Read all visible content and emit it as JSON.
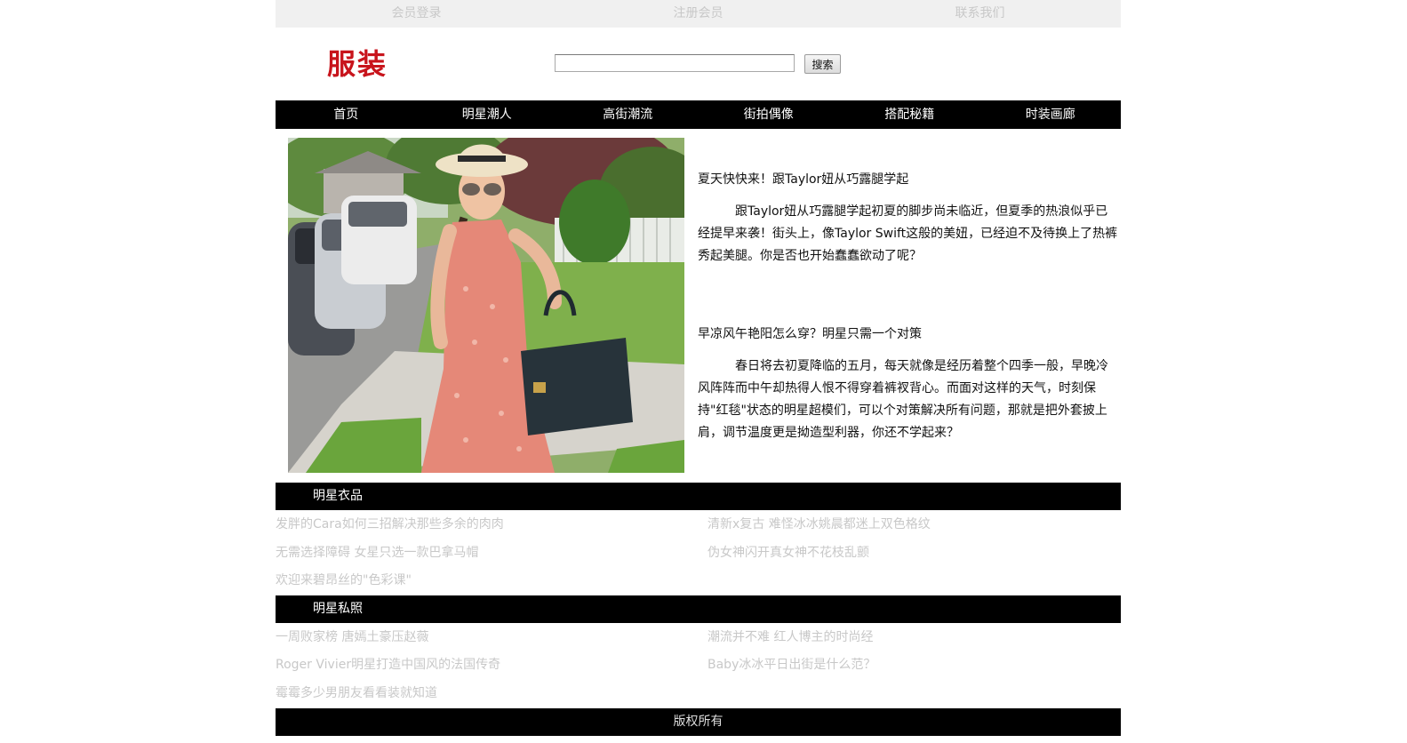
{
  "topbar": {
    "items": [
      {
        "label": "会员登录"
      },
      {
        "label": "注册会员"
      },
      {
        "label": "联系我们"
      }
    ]
  },
  "header": {
    "logo_text": "服装",
    "search_value": "",
    "search_button": "搜索"
  },
  "nav": {
    "items": [
      {
        "label": "首页"
      },
      {
        "label": "明星潮人"
      },
      {
        "label": "高街潮流"
      },
      {
        "label": "街拍偶像"
      },
      {
        "label": "搭配秘籍"
      },
      {
        "label": "时装画廊"
      }
    ]
  },
  "articles": [
    {
      "title": "夏天快快来！跟Taylor妞从巧露腿学起",
      "body": "跟Taylor妞从巧露腿学起初夏的脚步尚未临近，但夏季的热浪似乎已经提早来袭！街头上，像Taylor Swift这般的美妞，已经迫不及待换上了热裤秀起美腿。你是否也开始蠢蠢欲动了呢？"
    },
    {
      "title": "早凉风午艳阳怎么穿？明星只需一个对策",
      "body": "春日将去初夏降临的五月，每天就像是经历着整个四季一般，早晚冷风阵阵而中午却热得人恨不得穿着裤衩背心。而面对这样的天气，时刻保持\"红毯\"状态的明星超模们，可以个对策解决所有问题，那就是把外套披上肩，调节温度更是拗造型利器，你还不学起来？"
    }
  ],
  "sections": [
    {
      "title": "明星衣品",
      "links": [
        {
          "label": "发胖的Cara如何三招解决那些多余的肉肉"
        },
        {
          "label": "清新x复古 难怪冰冰姚晨都迷上双色格纹"
        },
        {
          "label": "无需选择障碍 女星只选一款巴拿马帽"
        },
        {
          "label": "伪女神闪开真女神不花枝乱颤"
        },
        {
          "label": "欢迎来碧昂丝的\"色彩课\""
        }
      ]
    },
    {
      "title": "明星私照",
      "links": [
        {
          "label": "一周败家榜 唐嫣土豪压赵薇"
        },
        {
          "label": "潮流并不难 红人博主的时尚经"
        },
        {
          "label": "Roger Vivier明星打造中国风的法国传奇"
        },
        {
          "label": "Baby冰冰平日出街是什么范？"
        },
        {
          "label": "霉霉多少男朋友看看装就知道"
        }
      ]
    }
  ],
  "footer": {
    "text": "版权所有"
  }
}
